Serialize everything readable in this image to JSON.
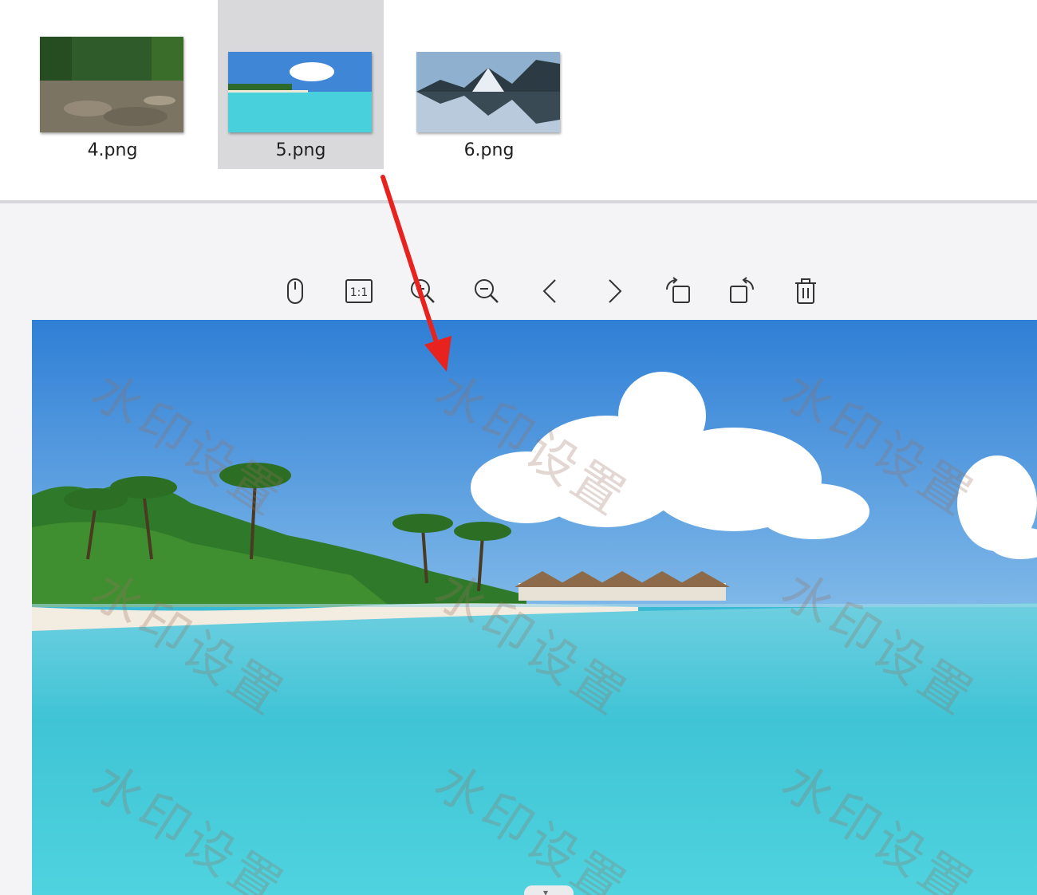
{
  "files": [
    {
      "name": "4.png",
      "selected": false
    },
    {
      "name": "5.png",
      "selected": true
    },
    {
      "name": "6.png",
      "selected": false
    }
  ],
  "toolbar": [
    {
      "icon": "mouse-icon"
    },
    {
      "icon": "actual-size-icon",
      "label": "1:1"
    },
    {
      "icon": "zoom-in-icon"
    },
    {
      "icon": "zoom-out-icon"
    },
    {
      "icon": "chevron-left-icon"
    },
    {
      "icon": "chevron-right-icon"
    },
    {
      "icon": "rotate-left-icon"
    },
    {
      "icon": "rotate-right-icon"
    },
    {
      "icon": "trash-icon"
    }
  ],
  "preview": {
    "watermark_text": "水印设置",
    "scroll_handle_glyph": "▾"
  },
  "colors": {
    "selected_tile": "#d9d9dc",
    "annotation_arrow": "#e8231f",
    "icon_stroke": "#333333"
  }
}
